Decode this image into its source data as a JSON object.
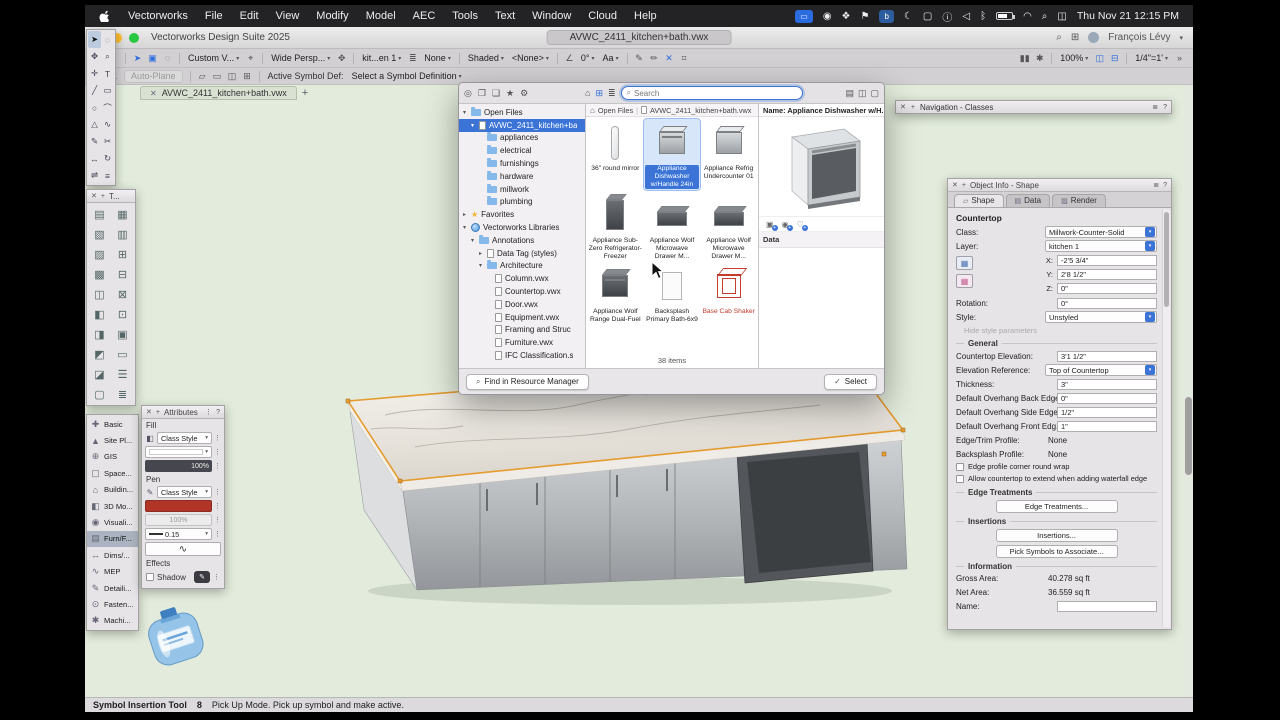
{
  "colors": {
    "accent_blue": "#3b74d6",
    "pen_red": "#b03527",
    "selection_orange": "#e69b2f",
    "canvas_green": "#e3ecdc"
  },
  "menubar": {
    "items": [
      "Vectorworks",
      "File",
      "Edit",
      "View",
      "Modify",
      "Model",
      "AEC",
      "Tools",
      "Text",
      "Window",
      "Cloud",
      "Help"
    ],
    "status_icons": [
      {
        "name": "screen-mirroring-badge",
        "glyph": "▭",
        "style": "badge"
      },
      {
        "name": "record-indicator-icon",
        "glyph": "◉",
        "style": ""
      },
      {
        "name": "dropbox-icon",
        "glyph": "❖",
        "style": ""
      },
      {
        "name": "location-icon",
        "glyph": "⚑",
        "style": ""
      },
      {
        "name": "bitwarden-icon",
        "glyph": "b",
        "style": "badge2"
      },
      {
        "name": "moon-icon",
        "glyph": "☾",
        "style": ""
      },
      {
        "name": "display-icon",
        "glyph": "▢",
        "style": ""
      },
      {
        "name": "info-icon",
        "glyph": "ⓘ",
        "style": ""
      },
      {
        "name": "volume-icon",
        "glyph": "◁",
        "style": ""
      },
      {
        "name": "bluetooth-icon",
        "glyph": "ᛒ",
        "style": ""
      },
      {
        "name": "battery-icon",
        "glyph": "",
        "style": "battery"
      },
      {
        "name": "wifi-icon",
        "glyph": "◠",
        "style": ""
      },
      {
        "name": "spotlight-icon",
        "glyph": "⌕",
        "style": ""
      },
      {
        "name": "control-center-icon",
        "glyph": "◫",
        "style": ""
      }
    ],
    "clock": "Thu Nov 21 12:15 PM"
  },
  "titlebar": {
    "app_title": "Vectorworks Design Suite 2025",
    "document_title": "AVWC_2411_kitchen+bath.vwx",
    "user": "François Lévy"
  },
  "toolbar1": {
    "items": [
      {
        "t": "i",
        "n": "back-icon",
        "g": "‹"
      },
      {
        "t": "i",
        "n": "forward-icon",
        "g": "›"
      },
      {
        "t": "s"
      },
      {
        "t": "i",
        "n": "select-mode-icon",
        "g": "➤",
        "sel": 1
      },
      {
        "t": "i",
        "n": "direct-select-icon",
        "g": "▣",
        "sel": 1
      },
      {
        "t": "i",
        "n": "lasso-mode-icon",
        "g": "◌"
      },
      {
        "t": "s"
      },
      {
        "t": "d",
        "n": "saved-views-dropdown",
        "g": "Custom V..."
      },
      {
        "t": "i",
        "n": "pin-view-icon",
        "g": "⌖"
      },
      {
        "t": "s"
      },
      {
        "t": "d",
        "n": "projection-dropdown",
        "g": "Wide Persp..."
      },
      {
        "t": "i",
        "n": "flyover-icon",
        "g": "✥"
      },
      {
        "t": "s"
      },
      {
        "t": "d",
        "n": "active-layer-dropdown",
        "g": "kit...en 1"
      },
      {
        "t": "i",
        "n": "layer-options-icon",
        "g": "≣"
      },
      {
        "t": "d",
        "n": "class-options-dropdown",
        "g": "None"
      },
      {
        "t": "s"
      },
      {
        "t": "d",
        "n": "render-mode-dropdown",
        "g": "Shaded"
      },
      {
        "t": "d",
        "n": "render-style-dropdown",
        "g": "<None>"
      },
      {
        "t": "s"
      },
      {
        "t": "i",
        "n": "angle-icon",
        "g": "∠"
      },
      {
        "t": "d",
        "n": "view-rotation-dropdown",
        "g": "0°"
      },
      {
        "t": "d",
        "n": "text-style-dropdown",
        "g": "Aa"
      },
      {
        "t": "s"
      },
      {
        "t": "i",
        "n": "pen-attributes-icon",
        "g": "✎"
      },
      {
        "t": "i",
        "n": "eyedropper-icon",
        "g": "✏"
      },
      {
        "t": "i",
        "n": "snap-disable-icon",
        "g": "✕",
        "sel": 1
      },
      {
        "t": "i",
        "n": "snap-grid-icon",
        "g": "⌗"
      }
    ]
  },
  "toolbar1_right": {
    "items": [
      {
        "t": "i",
        "n": "pause-icon",
        "g": "▮▮"
      },
      {
        "t": "i",
        "n": "refresh-icon",
        "g": "✱"
      },
      {
        "t": "s"
      },
      {
        "t": "d",
        "n": "zoom-dropdown",
        "g": "100%"
      },
      {
        "t": "i",
        "n": "multi-view-icon",
        "g": "◫",
        "sel": 1
      },
      {
        "t": "i",
        "n": "pane-layout-icon",
        "g": "⊟",
        "sel": 1
      },
      {
        "t": "s"
      },
      {
        "t": "d",
        "n": "scale-dropdown",
        "g": "1/4\"=1'"
      },
      {
        "t": "i",
        "n": "overflow-icon",
        "g": "»"
      }
    ]
  },
  "toolbar2": {
    "items": [
      {
        "t": "i",
        "n": "working-plane-icon",
        "g": "⊿"
      },
      {
        "t": "i",
        "n": "plane-angle-icon",
        "g": "∠"
      },
      {
        "t": "btnd",
        "n": "auto-plane-button",
        "g": "Auto-Plane"
      },
      {
        "t": "s"
      },
      {
        "t": "i",
        "n": "insert-mode-1-icon",
        "g": "▱"
      },
      {
        "t": "i",
        "n": "insert-mode-2-icon",
        "g": "▭"
      },
      {
        "t": "i",
        "n": "insert-mode-3-icon",
        "g": "◫"
      },
      {
        "t": "i",
        "n": "insert-mode-4-icon",
        "g": "⊞"
      },
      {
        "t": "s"
      },
      {
        "t": "label",
        "n": "active-symbol-label",
        "g": "Active Symbol Def:"
      },
      {
        "t": "d",
        "n": "symbol-definition-dropdown",
        "g": "Select a Symbol Definition"
      }
    ]
  },
  "doc_tab": {
    "title": "AVWC_2411_kitchen+bath.vwx"
  },
  "quick_tools": {
    "icons": [
      {
        "n": "selection-tool",
        "g": "➤",
        "sel": 1
      },
      {
        "n": "lasso-tool",
        "g": "◌"
      },
      {
        "n": "pan-tool",
        "g": "✥"
      },
      {
        "n": "zoom-tool",
        "g": "⌕"
      },
      {
        "n": "marker-tool",
        "g": "✛"
      },
      {
        "n": "text-tool",
        "g": "T"
      },
      {
        "n": "line-tool",
        "g": "╱"
      },
      {
        "n": "rectangle-tool",
        "g": "▭"
      },
      {
        "n": "circle-tool",
        "g": "○"
      },
      {
        "n": "arc-tool",
        "g": "⌒"
      },
      {
        "n": "triangle-tool",
        "g": "△"
      },
      {
        "n": "polyline-tool",
        "g": "∿"
      },
      {
        "n": "pencil-tool",
        "g": "✎"
      },
      {
        "n": "scissors-tool",
        "g": "✂"
      },
      {
        "n": "move-tool",
        "g": "↔"
      },
      {
        "n": "rotate-tool",
        "g": "↻"
      },
      {
        "n": "mirror-tool",
        "g": "⇌"
      },
      {
        "n": "stack-order-tool",
        "g": "≡"
      }
    ]
  },
  "tool_palette2": {
    "title": "T...",
    "icons": [
      {
        "n": "furnishing-tool-1",
        "g": "▤"
      },
      {
        "n": "furnishing-tool-2",
        "g": "▦"
      },
      {
        "n": "furnishing-tool-3",
        "g": "▧"
      },
      {
        "n": "furnishing-tool-4",
        "g": "▥"
      },
      {
        "n": "furnishing-tool-5",
        "g": "▨"
      },
      {
        "n": "furnishing-tool-6",
        "g": "⊞"
      },
      {
        "n": "furnishing-tool-7",
        "g": "▩"
      },
      {
        "n": "furnishing-tool-8",
        "g": "⊟"
      },
      {
        "n": "furnishing-tool-9",
        "g": "◫"
      },
      {
        "n": "furnishing-tool-10",
        "g": "⊠"
      },
      {
        "n": "furnishing-tool-11",
        "g": "◧"
      },
      {
        "n": "furnishing-tool-12",
        "g": "⊡"
      },
      {
        "n": "furnishing-tool-13",
        "g": "◨"
      },
      {
        "n": "furnishing-tool-14",
        "g": "▣"
      },
      {
        "n": "furnishing-tool-15",
        "g": "◩"
      },
      {
        "n": "furnishing-tool-16",
        "g": "▭"
      },
      {
        "n": "furnishing-tool-17",
        "g": "◪"
      },
      {
        "n": "furnishing-tool-18",
        "g": "☰"
      },
      {
        "n": "furnishing-tool-19",
        "g": "▢"
      },
      {
        "n": "furnishing-tool-20",
        "g": "≣"
      }
    ]
  },
  "tool_sets": {
    "items": [
      {
        "label": "Basic",
        "g": "✚"
      },
      {
        "label": "Site Pl...",
        "g": "▲"
      },
      {
        "label": "GIS",
        "g": "⊕"
      },
      {
        "label": "Space...",
        "g": "▢"
      },
      {
        "label": "Buildin...",
        "g": "⌂"
      },
      {
        "label": "3D Mo...",
        "g": "◧"
      },
      {
        "label": "Visuali...",
        "g": "◉"
      },
      {
        "label": "Furn/F...",
        "g": "▤",
        "sel": 1
      },
      {
        "label": "Dims/...",
        "g": "↔"
      },
      {
        "label": "MEP",
        "g": "∿"
      },
      {
        "label": "Detaili...",
        "g": "✎"
      },
      {
        "label": "Fasten...",
        "g": "⊙"
      },
      {
        "label": "Machi...",
        "g": "✱"
      }
    ]
  },
  "attributes": {
    "title": "Attributes",
    "fill_label": "Fill",
    "fill_style": "Class Style",
    "fill_opacity": "100%",
    "pen_label": "Pen",
    "pen_style": "Class Style",
    "pen_opacity": "100%",
    "line_weight": "0.15",
    "effects_label": "Effects",
    "shadow_label": "Shadow"
  },
  "resource_dialog": {
    "header_left": [
      {
        "n": "resource-target-icon",
        "g": "◎"
      },
      {
        "n": "resource-window-icon",
        "g": "❐"
      },
      {
        "n": "resource-people-icon",
        "g": "❑"
      },
      {
        "n": "resource-favorites-icon",
        "g": "★"
      },
      {
        "n": "resource-settings-icon",
        "g": "⚙"
      }
    ],
    "header_mid": [
      {
        "n": "view-home-icon",
        "g": "⌂"
      },
      {
        "n": "view-grid-icon",
        "g": "⊞",
        "sel": 1
      },
      {
        "n": "view-list-icon",
        "g": "≣"
      }
    ],
    "header_right": [
      {
        "n": "preview-pane-icon",
        "g": "▤"
      },
      {
        "n": "split-view-icon",
        "g": "◫"
      },
      {
        "n": "single-view-icon",
        "g": "▢"
      }
    ],
    "search_placeholder": "Search",
    "breadcrumb": {
      "root": "Open Files",
      "doc": "AVWC_2411_kitchen+bath.vwx"
    },
    "tree": [
      {
        "label": "Open Files",
        "level": 0,
        "icon": "folder",
        "disc": "open"
      },
      {
        "label": "AVWC_2411_kitchen+ba",
        "level": 1,
        "icon": "file",
        "disc": "open",
        "sel": 1
      },
      {
        "label": "appliances",
        "level": 2,
        "icon": "folder",
        "disc": ""
      },
      {
        "label": "electrical",
        "level": 2,
        "icon": "folder",
        "disc": ""
      },
      {
        "label": "furnishings",
        "level": 2,
        "icon": "folder",
        "disc": ""
      },
      {
        "label": "hardware",
        "level": 2,
        "icon": "folder",
        "disc": ""
      },
      {
        "label": "millwork",
        "level": 2,
        "icon": "folder",
        "disc": ""
      },
      {
        "label": "plumbing",
        "level": 2,
        "icon": "folder",
        "disc": ""
      },
      {
        "label": "Favorites",
        "level": 0,
        "icon": "star",
        "disc": "closed"
      },
      {
        "label": "Vectorworks Libraries",
        "level": 0,
        "icon": "globe",
        "disc": "open"
      },
      {
        "label": "Annotations",
        "level": 1,
        "icon": "folder",
        "disc": "open"
      },
      {
        "label": "Data Tag (styles)",
        "level": 2,
        "icon": "file",
        "disc": "closed"
      },
      {
        "label": "Architecture",
        "level": 2,
        "icon": "folder",
        "disc": "open"
      },
      {
        "label": "Column.vwx",
        "level": 3,
        "icon": "file",
        "disc": ""
      },
      {
        "label": "Countertop.vwx",
        "level": 3,
        "icon": "file",
        "disc": ""
      },
      {
        "label": "Door.vwx",
        "level": 3,
        "icon": "file",
        "disc": ""
      },
      {
        "label": "Equipment.vwx",
        "level": 3,
        "icon": "file",
        "disc": ""
      },
      {
        "label": "Framing and Struc",
        "level": 3,
        "icon": "file",
        "disc": ""
      },
      {
        "label": "Furniture.vwx",
        "level": 3,
        "icon": "file",
        "disc": ""
      },
      {
        "label": "IFC Classification.s",
        "level": 3,
        "icon": "file",
        "disc": ""
      }
    ],
    "symbols": [
      {
        "label": "36\" round mirror",
        "thumb": "mirror"
      },
      {
        "label": "Appliance Dishwasher w/Handle 24in",
        "thumb": "dishwasher",
        "sel": 1
      },
      {
        "label": "Appliance Refrig Undercounter 01",
        "thumb": "fridge"
      },
      {
        "label": "Appliance Sub-Zero Refrigerator-Freezer",
        "thumb": "subzero"
      },
      {
        "label": "Appliance Wolf Microwave Drawer M...",
        "thumb": "microwave"
      },
      {
        "label": "Appliance Wolf Microwave Drawer M...",
        "thumb": "microwave"
      },
      {
        "label": "Appliance Wolf Range Dual-Fuel",
        "thumb": "range"
      },
      {
        "label": "Backsplash Primary Bath-6x9",
        "thumb": "backsplash"
      },
      {
        "label": "Base Cab Shaker",
        "thumb": "redcab",
        "red": 1
      }
    ],
    "items_count": "38 items",
    "find_button": "Find in Resource Manager",
    "select_button": "Select",
    "preview": {
      "name": "Name: Appliance Dishwasher w/H...",
      "data_label": "Data"
    }
  },
  "navigation_palette": {
    "title": "Navigation - Classes"
  },
  "object_info": {
    "title": "Object Info - Shape",
    "tabs": [
      "Shape",
      "Data",
      "Render"
    ],
    "active_tab": 0,
    "rows": [
      {
        "kind": "title",
        "label": "Countertop"
      },
      {
        "kind": "dropdown",
        "name": "class-dropdown",
        "label": "Class:",
        "value": "Millwork-Counter-Solid"
      },
      {
        "kind": "dropdown",
        "name": "layer-dropdown",
        "label": "Layer:",
        "value": "kitchen 1"
      },
      {
        "kind": "xyz",
        "fields": [
          {
            "label": "X:",
            "value": "-2'5 3/4\"",
            "name": "x-coordinate-field"
          },
          {
            "label": "Y:",
            "value": "2'8 1/2\"",
            "name": "y-coordinate-field"
          },
          {
            "label": "Z:",
            "value": "0\"",
            "name": "z-coordinate-field"
          }
        ]
      },
      {
        "kind": "input",
        "name": "rotation-field",
        "label": "Rotation:",
        "value": "0°"
      },
      {
        "kind": "dropdown",
        "name": "style-dropdown",
        "label": "Style:",
        "value": "Unstyled"
      },
      {
        "kind": "center",
        "label": "Hide style parameters"
      },
      {
        "kind": "header",
        "label": "General"
      },
      {
        "kind": "input",
        "name": "countertop-elevation-field",
        "label": "Countertop Elevation:",
        "value": "3'1 1/2\""
      },
      {
        "kind": "dropdown",
        "name": "elevation-reference-dropdown",
        "label": "Elevation Reference:",
        "value": "Top of Countertop"
      },
      {
        "kind": "input",
        "name": "thickness-field",
        "label": "Thickness:",
        "value": "3\""
      },
      {
        "kind": "input",
        "name": "overhang-back-field",
        "label": "Default Overhang Back Edges:",
        "value": "0\""
      },
      {
        "kind": "input",
        "name": "overhang-side-field",
        "label": "Default Overhang Side Edges:",
        "value": "1/2\""
      },
      {
        "kind": "input",
        "name": "overhang-front-field",
        "label": "Default Overhang Front Edg...",
        "value": "1\""
      },
      {
        "kind": "static",
        "label": "Edge/Trim Profile:",
        "value": "None"
      },
      {
        "kind": "static",
        "label": "Backsplash Profile:",
        "value": "None"
      },
      {
        "kind": "check",
        "name": "edge-profile-corner-checkbox",
        "label": "Edge profile corner round wrap"
      },
      {
        "kind": "check",
        "name": "waterfall-edge-checkbox",
        "label": "Allow countertop to extend when adding waterfall edge"
      },
      {
        "kind": "header",
        "label": "Edge Treatments"
      },
      {
        "kind": "button",
        "name": "edge-treatments-button",
        "label": "Edge Treatments..."
      },
      {
        "kind": "header",
        "label": "Insertions"
      },
      {
        "kind": "button",
        "name": "insertions-button",
        "label": "Insertions..."
      },
      {
        "kind": "button",
        "name": "pick-symbols-button",
        "label": "Pick Symbols to Associate..."
      },
      {
        "kind": "header",
        "label": "Information"
      },
      {
        "kind": "static",
        "label": "Gross Area:",
        "value": "40.278 sq ft"
      },
      {
        "kind": "static",
        "label": "Net Area:",
        "value": "36.559 sq ft"
      },
      {
        "kind": "input",
        "name": "name-field",
        "label": "Name:",
        "value": ""
      }
    ]
  },
  "statusbar": {
    "tool": "Symbol Insertion Tool",
    "shortcut": "8",
    "message": "Pick Up Mode. Pick up symbol and make active."
  }
}
